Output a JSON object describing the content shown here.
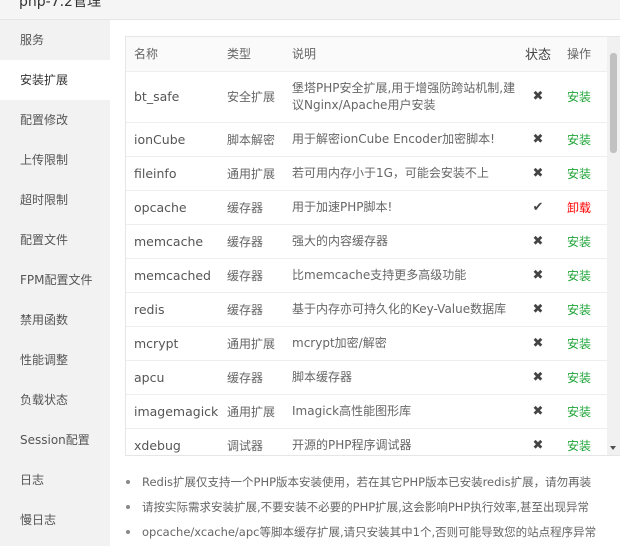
{
  "window": {
    "title": "php-7.2管理"
  },
  "sidebar": {
    "items": [
      {
        "label": "服务"
      },
      {
        "label": "安装扩展"
      },
      {
        "label": "配置修改"
      },
      {
        "label": "上传限制"
      },
      {
        "label": "超时限制"
      },
      {
        "label": "配置文件"
      },
      {
        "label": "FPM配置文件"
      },
      {
        "label": "禁用函数"
      },
      {
        "label": "性能调整"
      },
      {
        "label": "负载状态"
      },
      {
        "label": "Session配置"
      },
      {
        "label": "日志"
      },
      {
        "label": "慢日志"
      }
    ],
    "active_index": 1
  },
  "table": {
    "headers": {
      "name": "名称",
      "type": "类型",
      "desc": "说明",
      "status": "状态",
      "op": "操作"
    },
    "rows": [
      {
        "name": "bt_safe",
        "type": "安全扩展",
        "desc": "堡塔PHP安全扩展,用于增强防跨站机制,建议Nginx/Apache用户安装",
        "status": "✖",
        "op": "安装"
      },
      {
        "name": "ionCube",
        "type": "脚本解密",
        "desc": "用于解密ionCube Encoder加密脚本!",
        "status": "✖",
        "op": "安装"
      },
      {
        "name": "fileinfo",
        "type": "通用扩展",
        "desc": "若可用内存小于1G，可能会安装不上",
        "status": "✖",
        "op": "安装"
      },
      {
        "name": "opcache",
        "type": "缓存器",
        "desc": "用于加速PHP脚本!",
        "status": "✔",
        "op": "卸载"
      },
      {
        "name": "memcache",
        "type": "缓存器",
        "desc": "强大的内容缓存器",
        "status": "✖",
        "op": "安装"
      },
      {
        "name": "memcached",
        "type": "缓存器",
        "desc": "比memcache支持更多高级功能",
        "status": "✖",
        "op": "安装"
      },
      {
        "name": "redis",
        "type": "缓存器",
        "desc": "基于内存亦可持久化的Key-Value数据库",
        "status": "✖",
        "op": "安装"
      },
      {
        "name": "mcrypt",
        "type": "通用扩展",
        "desc": "mcrypt加密/解密",
        "status": "✖",
        "op": "安装"
      },
      {
        "name": "apcu",
        "type": "缓存器",
        "desc": "脚本缓存器",
        "status": "✖",
        "op": "安装"
      },
      {
        "name": "imagemagick",
        "type": "通用扩展",
        "desc": "Imagick高性能图形库",
        "status": "✖",
        "op": "安装"
      },
      {
        "name": "xdebug",
        "type": "调试器",
        "desc": "开源的PHP程序调试器",
        "status": "✖",
        "op": "安装"
      }
    ]
  },
  "notes": [
    "Redis扩展仅支持一个PHP版本安装使用，若在其它PHP版本已安装redis扩展，请勿再装",
    "请按实际需求安装扩展,不要安装不必要的PHP扩展,这会影响PHP执行效率,甚至出现异常",
    "opcache/xcache/apc等脚本缓存扩展,请只安装其中1个,否则可能导致您的站点程序异常"
  ],
  "colors": {
    "install": "#20a53a",
    "uninstall": "#ff0000",
    "sidebar_bg": "#f2f2f2"
  }
}
